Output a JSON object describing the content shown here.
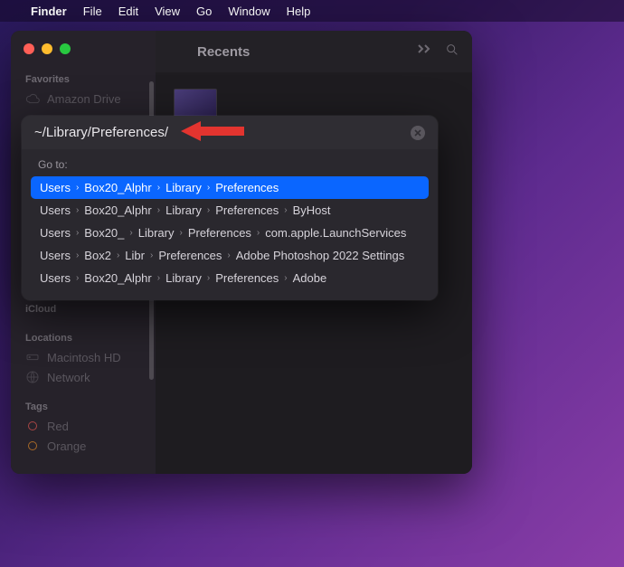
{
  "menubar": {
    "apple": "",
    "app": "Finder",
    "items": [
      "File",
      "Edit",
      "View",
      "Go",
      "Window",
      "Help"
    ]
  },
  "window": {
    "title": "Recents"
  },
  "sidebar": {
    "sections": [
      {
        "label": "Favorites",
        "items": [
          {
            "icon": "cloud",
            "label": "Amazon Drive"
          }
        ]
      },
      {
        "label": "iCloud",
        "items": []
      },
      {
        "label": "Locations",
        "items": [
          {
            "icon": "disk",
            "label": "Macintosh HD"
          },
          {
            "icon": "globe",
            "label": "Network"
          }
        ]
      },
      {
        "label": "Tags",
        "items": [
          {
            "icon": "tag-red",
            "label": "Red"
          },
          {
            "icon": "tag-orange",
            "label": "Orange"
          }
        ]
      }
    ]
  },
  "goto": {
    "input_value": "~/Library/Preferences/",
    "label": "Go to:",
    "suggestions": [
      {
        "segments": [
          "Users",
          "Box20_Alphr",
          "Library",
          "Preferences"
        ],
        "selected": true
      },
      {
        "segments": [
          "Users",
          "Box20_Alphr",
          "Library",
          "Preferences",
          "ByHost"
        ],
        "selected": false
      },
      {
        "segments": [
          "Users",
          "Box20_",
          "Library",
          "Preferences",
          "com.apple.LaunchServices"
        ],
        "selected": false
      },
      {
        "segments": [
          "Users",
          "Box2",
          "Libr",
          "Preferences",
          "Adobe Photoshop 2022 Settings"
        ],
        "selected": false
      },
      {
        "segments": [
          "Users",
          "Box20_Alphr",
          "Library",
          "Preferences",
          "Adobe"
        ],
        "selected": false
      }
    ]
  },
  "colors": {
    "accent": "#0a66ff",
    "arrow": "#e3342f"
  }
}
